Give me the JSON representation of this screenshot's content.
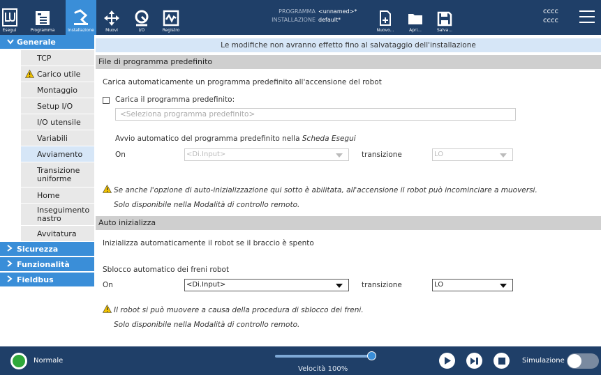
{
  "topbar": {
    "buttons": [
      {
        "label": "Esegui",
        "icon": "run-icon"
      },
      {
        "label": "Programma",
        "icon": "program-icon"
      },
      {
        "label": "Installazione",
        "icon": "installation-icon"
      },
      {
        "label": "Muovi",
        "icon": "move-icon"
      },
      {
        "label": "I/O",
        "icon": "io-icon"
      },
      {
        "label": "Registro",
        "icon": "log-icon"
      },
      {
        "label": "Nuovo...",
        "icon": "new-file-icon"
      },
      {
        "label": "Apri...",
        "icon": "folder-icon"
      },
      {
        "label": "Salva...",
        "icon": "save-icon"
      }
    ],
    "program_key": "PROGRAMMA",
    "program_value": "<unnamed>*",
    "install_key": "INSTALLAZIONE",
    "install_value": "default*",
    "user_line1": "cccc",
    "user_line2": "cccc"
  },
  "sidebar": {
    "groups": [
      {
        "label": "Generale"
      },
      {
        "label": "Sicurezza"
      },
      {
        "label": "Funzionalità"
      },
      {
        "label": "Fieldbus"
      }
    ],
    "items": [
      {
        "label": "TCP"
      },
      {
        "label": "Carico utile"
      },
      {
        "label": "Montaggio"
      },
      {
        "label": "Setup I/O"
      },
      {
        "label": "I/O utensile"
      },
      {
        "label": "Variabili"
      },
      {
        "label": "Avviamento"
      },
      {
        "label": "Transizione uniforme"
      },
      {
        "label": "Home"
      },
      {
        "label": "Inseguimento nastro"
      },
      {
        "label": "Avvitatura"
      }
    ]
  },
  "main": {
    "banner": "Le modifiche non avranno effetto fino al salvataggio dell'installazione",
    "section1": {
      "header": "File di programma predefinito",
      "description": "Carica automaticamente un programma predefinito all'accensione del robot",
      "checkbox_label": "Carica il programma predefinito:",
      "program_placeholder": "<Seleziona programma predefinito>",
      "autostart_label": "Avvio automatico del programma predefinito nella",
      "autostart_italic": "Scheda Esegui",
      "on_label": "On",
      "input_value": "<Di.Input>",
      "transition_label": "transizione",
      "transition_value": "LO",
      "warning": "Se anche l'opzione di auto-inizializzazione qui sotto è abilitata, all'accensione il robot può incominciare a muoversi.",
      "remote_note": "Solo disponibile nella Modalità di controllo remoto."
    },
    "section2": {
      "header": "Auto inizializza",
      "description": "Inizializza automaticamente il robot se il braccio è spento",
      "brake_label": "Sblocco automatico dei freni robot",
      "on_label": "On",
      "input_value": "<Di.Input>",
      "transition_label": "transizione",
      "transition_value": "LO",
      "warning": "Il robot si può muovere a causa della procedura di sblocco dei freni.",
      "remote_note": "Solo disponibile nella Modalità di controllo remoto."
    }
  },
  "bottombar": {
    "status": "Normale",
    "speed": "Velocità 100%",
    "speed_fraction": 1.0,
    "simulation_label": "Simulazione"
  },
  "colors": {
    "topbar": "#1f3f68",
    "accent": "#3a8ed8",
    "banner": "#d6e6f7",
    "status_ok": "#2fa83a",
    "warning": "#f2c200"
  }
}
